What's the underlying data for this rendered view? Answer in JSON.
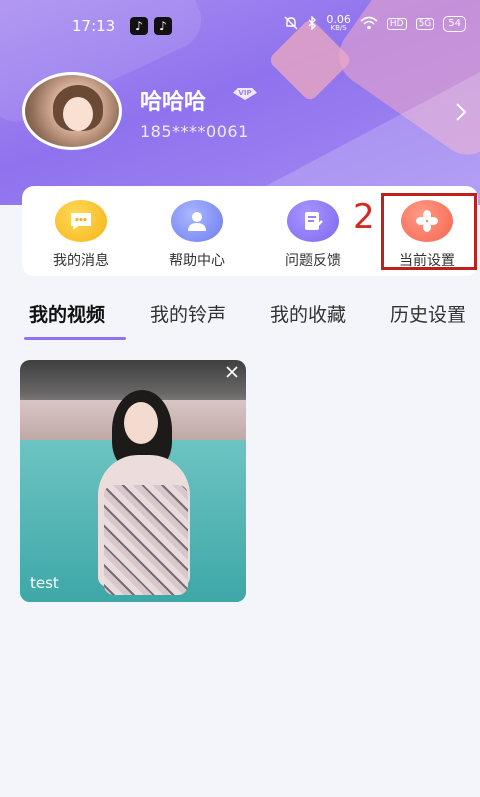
{
  "status_bar": {
    "time": "17:13",
    "network_speed": "0.06",
    "network_unit": "KB/S",
    "hd_label": "HD",
    "signal_label": "5G",
    "battery": "54"
  },
  "profile": {
    "username": "哈哈哈",
    "vip_label": "VIP",
    "phone": "185****0061"
  },
  "quick_actions": [
    {
      "label": "我的消息"
    },
    {
      "label": "帮助中心"
    },
    {
      "label": "问题反馈"
    },
    {
      "label": "当前设置"
    }
  ],
  "annotation": {
    "step": "2",
    "color": "#c0201b"
  },
  "tabs": [
    {
      "label": "我的视频"
    },
    {
      "label": "我的铃声"
    },
    {
      "label": "我的收藏"
    },
    {
      "label": "历史设置"
    }
  ],
  "videos": [
    {
      "title": "test"
    }
  ],
  "colors": {
    "accent": "#8f72ee",
    "header": "#9b84ee",
    "background": "#f4f5fb"
  }
}
